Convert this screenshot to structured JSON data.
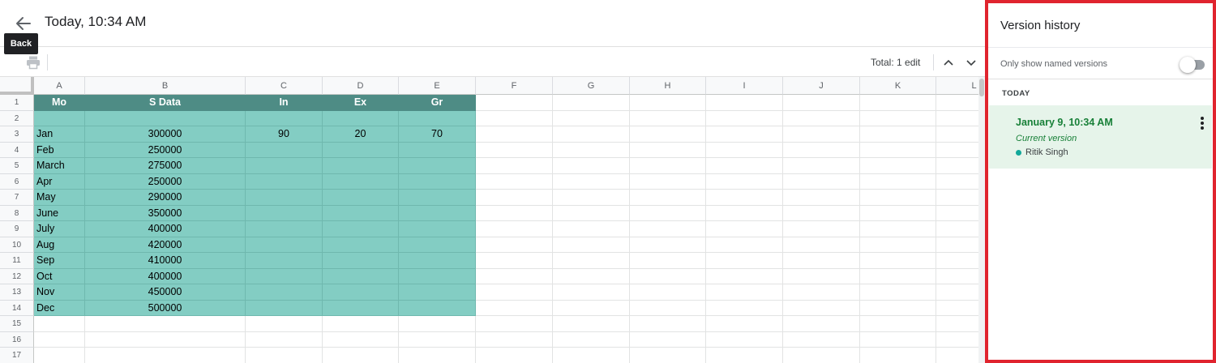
{
  "header": {
    "back_tooltip": "Back",
    "title": "Today, 10:34 AM",
    "total_edits": "Total: 1 edit"
  },
  "grid": {
    "columns": [
      "A",
      "B",
      "C",
      "D",
      "E",
      "F",
      "G",
      "H",
      "I",
      "J",
      "K",
      "L"
    ],
    "rows": [
      "1",
      "2",
      "3",
      "4",
      "5",
      "6",
      "7",
      "8",
      "9",
      "10",
      "11",
      "12",
      "13",
      "14",
      "15",
      "16",
      "17"
    ],
    "header_row": [
      "Mo",
      "S Data",
      "In",
      "Ex",
      "Gr"
    ],
    "data_rows": [
      [
        "",
        "",
        "",
        "",
        ""
      ],
      [
        "Jan",
        "300000",
        "90",
        "20",
        "70"
      ],
      [
        "Feb",
        "250000",
        "",
        "",
        ""
      ],
      [
        "March",
        "275000",
        "",
        "",
        ""
      ],
      [
        "Apr",
        "250000",
        "",
        "",
        ""
      ],
      [
        "May",
        "290000",
        "",
        "",
        ""
      ],
      [
        "June",
        "350000",
        "",
        "",
        ""
      ],
      [
        "July",
        "400000",
        "",
        "",
        ""
      ],
      [
        "Aug",
        "420000",
        "",
        "",
        ""
      ],
      [
        "Sep",
        "410000",
        "",
        "",
        ""
      ],
      [
        "Oct",
        "400000",
        "",
        "",
        ""
      ],
      [
        "Nov",
        "450000",
        "",
        "",
        ""
      ],
      [
        "Dec",
        "500000",
        "",
        "",
        ""
      ]
    ],
    "colors": {
      "header_fill": "#4e8c85",
      "data_fill": "#83cdc3"
    }
  },
  "version_panel": {
    "title": "Version history",
    "named_versions_label": "Only show named versions",
    "named_versions_on": false,
    "section": "TODAY",
    "versions": [
      {
        "date": "January 9, 10:34 AM",
        "subtitle": "Current version",
        "author": "Ritik Singh"
      }
    ],
    "colors": {
      "border": "#e0242e",
      "selected_bg": "#e6f4ea",
      "date_text": "#188038",
      "author_dot": "#12a89a"
    }
  },
  "icons": [
    "back-arrow-icon",
    "print-icon",
    "chevron-up-icon",
    "chevron-down-icon",
    "more-vert-icon"
  ]
}
